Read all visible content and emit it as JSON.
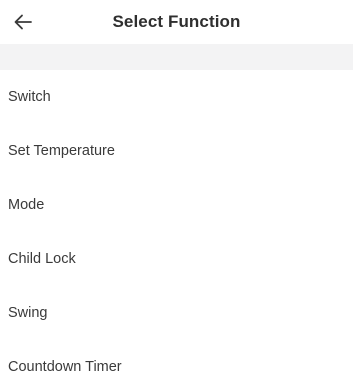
{
  "header": {
    "title": "Select Function",
    "back_icon": "arrow-left-icon"
  },
  "functions": [
    {
      "label": "Switch"
    },
    {
      "label": "Set Temperature"
    },
    {
      "label": "Mode"
    },
    {
      "label": "Child Lock"
    },
    {
      "label": "Swing"
    },
    {
      "label": "Countdown Timer"
    }
  ],
  "colors": {
    "background": "#ffffff",
    "band": "#f3f3f4",
    "text": "#333333"
  }
}
